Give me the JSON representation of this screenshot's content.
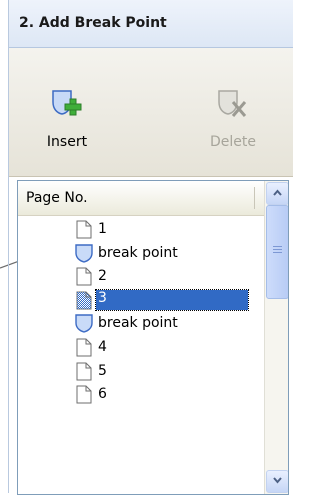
{
  "panel": {
    "title": "2. Add Break Point"
  },
  "toolbar": {
    "insert_label": "Insert",
    "delete_label": "Delete",
    "insert_icon": "insert-break-icon",
    "delete_icon": "delete-break-icon",
    "delete_enabled": false
  },
  "list": {
    "column_header": "Page No.",
    "rows": [
      {
        "type": "page",
        "label": "1",
        "icon": "page-icon"
      },
      {
        "type": "break",
        "label": "break point",
        "icon": "break-point-icon"
      },
      {
        "type": "page",
        "label": "2",
        "icon": "page-icon"
      },
      {
        "type": "page",
        "label": "3",
        "icon": "page-icon",
        "selected": true
      },
      {
        "type": "break",
        "label": "break point",
        "icon": "break-point-icon"
      },
      {
        "type": "page",
        "label": "4",
        "icon": "page-icon"
      },
      {
        "type": "page",
        "label": "5",
        "icon": "page-icon"
      },
      {
        "type": "page",
        "label": "6",
        "icon": "page-icon"
      }
    ]
  },
  "colors": {
    "selection": "#316ac5",
    "header_bg": "#dde7f5",
    "toolbar_bg": "#e6e3d8"
  }
}
